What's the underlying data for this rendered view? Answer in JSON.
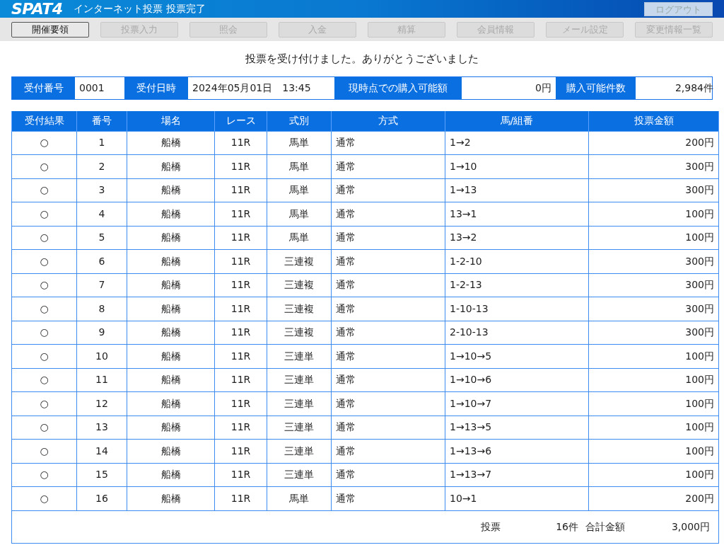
{
  "header": {
    "logo": "SPAT4",
    "title": "インターネット投票 投票完了",
    "logout": {
      "label": "ログアウト",
      "disabled": true
    }
  },
  "nav": [
    {
      "label": "開催要領",
      "disabled": false
    },
    {
      "label": "投票入力",
      "disabled": true
    },
    {
      "label": "照会",
      "disabled": true
    },
    {
      "label": "入金",
      "disabled": true
    },
    {
      "label": "精算",
      "disabled": true
    },
    {
      "label": "会員情報",
      "disabled": true
    },
    {
      "label": "メール設定",
      "disabled": true
    },
    {
      "label": "変更情報一覧",
      "disabled": true
    }
  ],
  "message": "投票を受け付けました。ありがとうございました",
  "info": [
    {
      "label": "受付番号",
      "value": "0001"
    },
    {
      "label": "受付日時",
      "value": "2024年05月01日　13:45"
    },
    {
      "label": "現時点での購入可能額",
      "value": "0円"
    },
    {
      "label": "購入可能件数",
      "value": "2,984件"
    }
  ],
  "table": {
    "columns": [
      "受付結果",
      "番号",
      "場名",
      "レース",
      "式別",
      "方式",
      "馬/組番",
      "投票金額"
    ],
    "rows": [
      [
        "○",
        "1",
        "船橋",
        "11R",
        "馬単",
        "通常",
        "1→2",
        "200円"
      ],
      [
        "○",
        "2",
        "船橋",
        "11R",
        "馬単",
        "通常",
        "1→10",
        "300円"
      ],
      [
        "○",
        "3",
        "船橋",
        "11R",
        "馬単",
        "通常",
        "1→13",
        "300円"
      ],
      [
        "○",
        "4",
        "船橋",
        "11R",
        "馬単",
        "通常",
        "13→1",
        "100円"
      ],
      [
        "○",
        "5",
        "船橋",
        "11R",
        "馬単",
        "通常",
        "13→2",
        "100円"
      ],
      [
        "○",
        "6",
        "船橋",
        "11R",
        "三連複",
        "通常",
        "1-2-10",
        "300円"
      ],
      [
        "○",
        "7",
        "船橋",
        "11R",
        "三連複",
        "通常",
        "1-2-13",
        "300円"
      ],
      [
        "○",
        "8",
        "船橋",
        "11R",
        "三連複",
        "通常",
        "1-10-13",
        "300円"
      ],
      [
        "○",
        "9",
        "船橋",
        "11R",
        "三連複",
        "通常",
        "2-10-13",
        "300円"
      ],
      [
        "○",
        "10",
        "船橋",
        "11R",
        "三連単",
        "通常",
        "1→10→5",
        "100円"
      ],
      [
        "○",
        "11",
        "船橋",
        "11R",
        "三連単",
        "通常",
        "1→10→6",
        "100円"
      ],
      [
        "○",
        "12",
        "船橋",
        "11R",
        "三連単",
        "通常",
        "1→10→7",
        "100円"
      ],
      [
        "○",
        "13",
        "船橋",
        "11R",
        "三連単",
        "通常",
        "1→13→5",
        "100円"
      ],
      [
        "○",
        "14",
        "船橋",
        "11R",
        "三連単",
        "通常",
        "1→13→6",
        "100円"
      ],
      [
        "○",
        "15",
        "船橋",
        "11R",
        "三連単",
        "通常",
        "1→13→7",
        "100円"
      ],
      [
        "○",
        "16",
        "船橋",
        "11R",
        "馬単",
        "通常",
        "10→1",
        "200円"
      ]
    ],
    "footer": {
      "count_label": "投票",
      "count": "16件",
      "total_label": "合計金額",
      "total": "3,000円"
    }
  }
}
